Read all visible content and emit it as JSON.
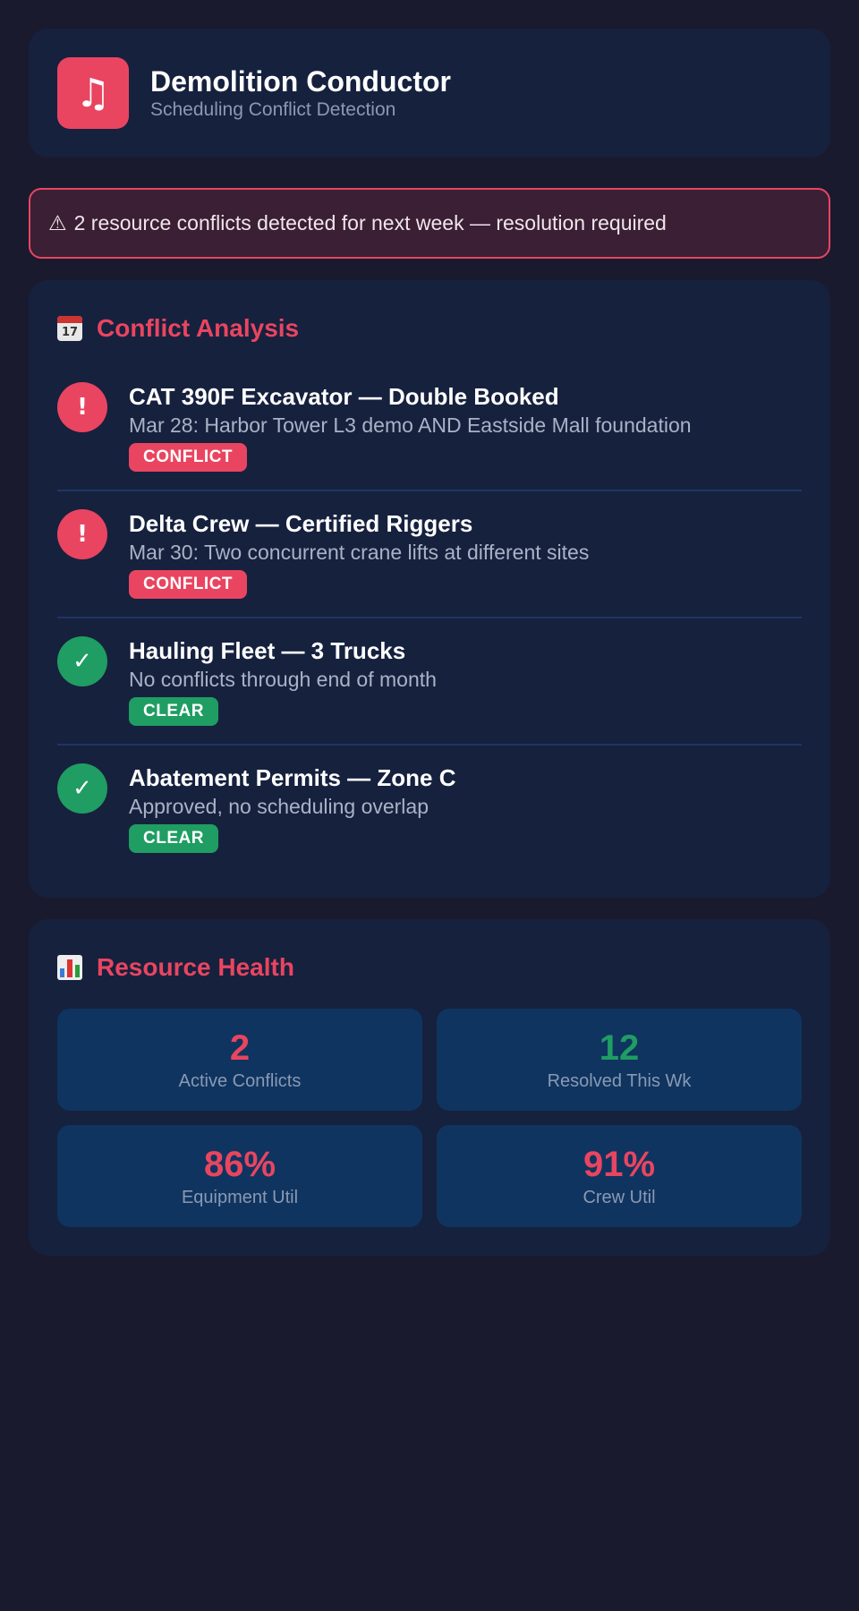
{
  "app": {
    "icon": "music-note-icon",
    "title": "Demolition Conductor",
    "subtitle": "Scheduling Conflict Detection"
  },
  "alert": {
    "icon": "⚠",
    "text": "2 resource conflicts detected for next week — resolution required"
  },
  "conflicts": {
    "icon": "calendar-icon",
    "title": "Conflict Analysis",
    "items": [
      {
        "status_icon": "!",
        "title": "CAT 390F Excavator — Double Booked",
        "description": "Mar 28: Harbor Tower L3 demo AND Eastside Mall foundation",
        "badge": "CONFLICT",
        "status": "conflict"
      },
      {
        "status_icon": "!",
        "title": "Delta Crew — Certified Riggers",
        "description": "Mar 30: Two concurrent crane lifts at different sites",
        "badge": "CONFLICT",
        "status": "conflict"
      },
      {
        "status_icon": "✓",
        "title": "Hauling Fleet — 3 Trucks",
        "description": "No conflicts through end of month",
        "badge": "CLEAR",
        "status": "clear"
      },
      {
        "status_icon": "✓",
        "title": "Abatement Permits — Zone C",
        "description": "Approved, no scheduling overlap",
        "badge": "CLEAR",
        "status": "clear"
      }
    ]
  },
  "health": {
    "icon": "bar-chart-icon",
    "title": "Resource Health",
    "stats": [
      {
        "value": "2",
        "label": "Active Conflicts",
        "color": "#e94560"
      },
      {
        "value": "12",
        "label": "Resolved This Wk",
        "color": "#1f9d63"
      },
      {
        "value": "86%",
        "label": "Equipment Util",
        "color": "#e94560"
      },
      {
        "value": "91%",
        "label": "Crew Util",
        "color": "#e94560"
      }
    ]
  },
  "colors": {
    "background": "#1a1a2e",
    "card": "#16213e",
    "accent": "#e94560",
    "success": "#1f9d63",
    "stat_tile": "#0f3460"
  }
}
